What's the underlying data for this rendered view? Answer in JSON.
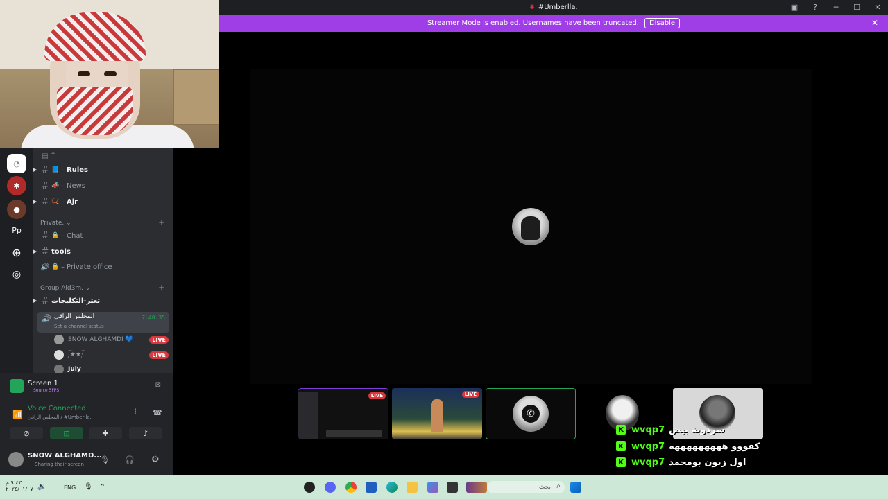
{
  "titlebar": {
    "title": "#Umberlla."
  },
  "banner": {
    "text": "Streamer Mode is enabled. Usernames have been truncated.",
    "button": "Disable"
  },
  "rail": {
    "dm_label": "Pp"
  },
  "channels": {
    "top": [
      {
        "name": "Rules",
        "prefix": "–",
        "emoji": "📘",
        "unread": true
      },
      {
        "name": "News",
        "prefix": "–",
        "emoji": "📣",
        "unread": false
      },
      {
        "name": "Ajr",
        "prefix": "–",
        "emoji": "📿",
        "unread": true
      }
    ],
    "private_category": "Private.",
    "private": [
      {
        "name": "Chat",
        "prefix": "–",
        "emoji": "🔒",
        "unread": false
      },
      {
        "name": "tools",
        "prefix": "",
        "emoji": "",
        "unread": true
      },
      {
        "name": "Private office",
        "prefix": "–",
        "emoji": "🔒",
        "unread": false
      }
    ],
    "group_category": "Group Ald3m.",
    "group_text": "تعتر-التكليجات",
    "voice_channel": {
      "name": "المجلس الراقي",
      "timer": "7:40:35",
      "status": "Set a channel status"
    },
    "voice_users": [
      {
        "name": "SNOW ALGHAMDI 💙",
        "live": "LIVE"
      },
      {
        "name": "·̩͡★★·̩͡",
        "live": "LIVE"
      },
      {
        "name": "July",
        "live": ""
      }
    ]
  },
  "panel": {
    "screen_title": "Screen 1",
    "screen_sub": "Source 5FPS",
    "voice_status": "Voice Connected",
    "voice_location": "المجلس الراقي / #Umberlla.",
    "user_name": "SNOW ALGHAMD...",
    "user_status": "Sharing their screen"
  },
  "tiles": [
    {
      "live": "LIVE"
    },
    {
      "live": "LIVE"
    },
    {
      "live": ""
    }
  ],
  "chat": [
    {
      "user": "wvqp7",
      "msg": "سردوبة بيض"
    },
    {
      "user": "wvqp7",
      "msg": "كفووو هههههههههه"
    },
    {
      "user": "wvqp7",
      "msg": "اول زيون بومحمد"
    }
  ],
  "taskbar": {
    "time": "٩:٤٣ م",
    "date": "٢٠٢٤/٠١/٠٧",
    "lang": "ENG",
    "search_placeholder": "بحث"
  },
  "colors": {
    "accent": "#9f3de6",
    "live": "#da373c",
    "kick": "#53fc18",
    "voice": "#23a559"
  }
}
